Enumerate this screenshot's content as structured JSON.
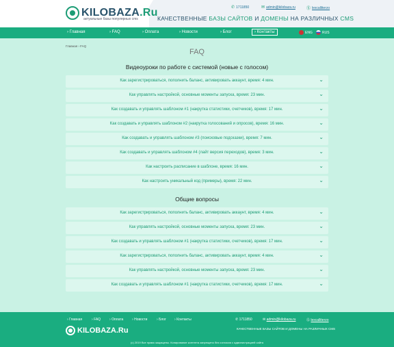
{
  "header": {
    "logo_text": "KILOBAZA",
    "logo_dot": ".Ru",
    "logo_sub": "актуальные базы популярных cms",
    "phone": "1711850",
    "email": "admin@kilobaza.ru",
    "skype": "lexcalliterzo",
    "tagline_1": "КАЧЕСТВЕННЫЕ",
    "tagline_2": "БАЗЫ САЙТОВ",
    "tagline_3": "И",
    "tagline_4": "ДОМЕНЫ",
    "tagline_5": "НА РАЗЛИЧНЫХ",
    "tagline_6": "CMS"
  },
  "nav": {
    "items": [
      "Главная",
      "FAQ",
      "Оплата",
      "Новости",
      "Блог",
      "Контакты"
    ],
    "active": "Контакты",
    "lang_en": "ENG",
    "lang_ru": "RUS"
  },
  "breadcrumb": "Главная › FAQ",
  "page_title": "FAQ",
  "sections": [
    {
      "title": "Видеоуроки по работе с системой (новые с голосом)",
      "items": [
        "Как зарегистрироваться, пополнить баланс, активировать аккаунт, время: 4 мин.",
        "Как управлять настройкой, основные моменты запуска, время: 23 мин.",
        "Как создавать и управлять шаблоном #1 (накрутка статистики, счетчиков), время: 17 мин.",
        "Как создавать и управлять шаблоном #2 (накрутка голосований и опросов), время: 16 мин.",
        "Как создавать и управлять шаблоном #3 (поисковые подсказки), время: 7 мин.",
        "Как создавать и управлять шаблоном #4 (лайт версия переходов), время: 3 мин.",
        "Как настроить расписание в шаблоне, время: 16 мин.",
        "Как настроить уникальный код (примеры), время: 22 мин."
      ]
    },
    {
      "title": "Общие вопросы",
      "items": [
        "Как зарегистрироваться, пополнить баланс, активировать аккаунт, время: 4 мин.",
        "Как управлять настройкой, основные моменты запуска, время: 23 мин.",
        "Как создавать и управлять шаблоном #1 (накрутка статистики, счетчиков), время: 17 мин.",
        "Как зарегистрироваться, пополнить баланс, активировать аккаунт, время: 4 мин.",
        "Как управлять настройкой, основные моменты запуска, время: 23 мин.",
        "Как создавать и управлять шаблоном #1 (накрутка статистики, счетчиков), время: 17 мин."
      ]
    }
  ],
  "footer": {
    "nav": [
      "Главная",
      "FAQ",
      "Оплата",
      "Новости",
      "Блог",
      "Контакты"
    ],
    "phone": "1711850",
    "email": "admin@kilobaza.ru",
    "skype": "lexcalliterzo",
    "logo_text": "KILOBAZA",
    "logo_dot": ".Ru",
    "tagline": "КАЧЕСТВЕННЫЕ БАЗЫ САЙТОВ И ДОМЕНЫ НА РАЗЛИЧНЫХ CMS",
    "copyright": "(с) 2019 Все права защищены. Копирование контента запрещено без согласия с администрацией сайта"
  },
  "colors": {
    "accent": "#1aad80",
    "background": "#c9f2e4",
    "item_bg": "#dcf7ee",
    "brand_dark": "#29536b"
  },
  "icons": {
    "phone": "phone-icon",
    "email": "mail-icon",
    "skype": "skype-icon",
    "chevron": "chevron-down-icon"
  }
}
